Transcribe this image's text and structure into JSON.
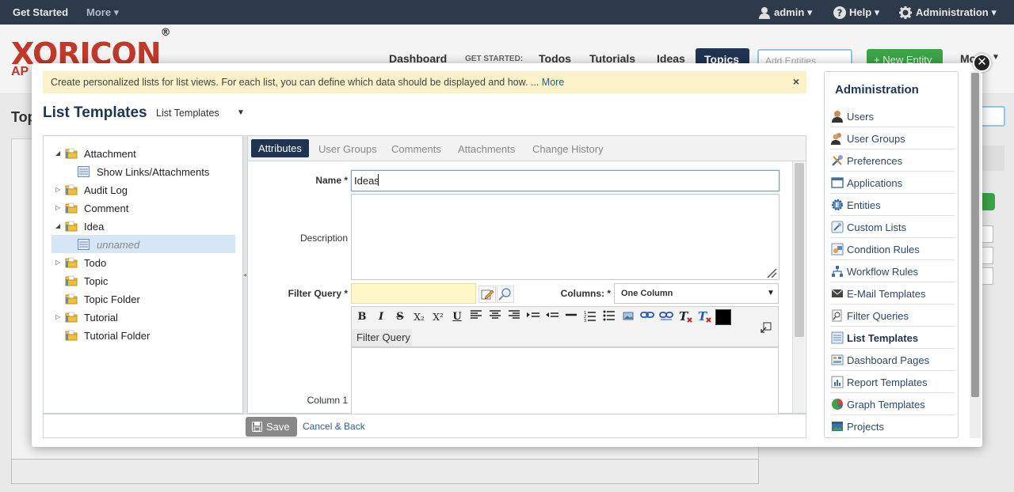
{
  "topbar": {
    "get_started": "Get Started",
    "more": "More ▾",
    "user": "admin ▾",
    "help": "Help ▾",
    "administration": "Administration ▾"
  },
  "background": {
    "logo": "XORICON",
    "logo_reg": "®",
    "logo_sub": "AP",
    "nav": {
      "dashboard": "Dashboard",
      "get_started_label": "GET STARTED:",
      "todos": "Todos",
      "tutorials": "Tutorials",
      "ideas": "Ideas",
      "topics": "Topics"
    },
    "search_placeholder": "Add Entities",
    "new_entity": "New Entity",
    "more": "Mo",
    "page_title": "Top"
  },
  "notice": {
    "text": "Create personalized lists for list views. For each list, you can define which data should be displayed and how. ...",
    "more": "More",
    "close": "×"
  },
  "header": {
    "title": "List Templates",
    "selector": "List Templates",
    "selector_arrow": "▼"
  },
  "tree": [
    {
      "label": "Attachment",
      "expander": "◢",
      "icon": "folder-icon",
      "italic": false
    },
    {
      "label": "Show Links/Attachments",
      "expander": "",
      "icon": "list-icon",
      "italic": false
    },
    {
      "label": "Audit Log",
      "expander": "▷",
      "icon": "folder-icon",
      "italic": false
    },
    {
      "label": "Comment",
      "expander": "▷",
      "icon": "folder-icon",
      "italic": false
    },
    {
      "label": "Idea",
      "expander": "◢",
      "icon": "folder-icon",
      "italic": false
    },
    {
      "label": "unnamed",
      "expander": "",
      "icon": "list-icon",
      "italic": true
    },
    {
      "label": "Todo",
      "expander": "▷",
      "icon": "folder-icon",
      "italic": false
    },
    {
      "label": "Topic",
      "expander": "",
      "icon": "folder-icon",
      "italic": false
    },
    {
      "label": "Topic Folder",
      "expander": "",
      "icon": "folder-icon",
      "italic": false
    },
    {
      "label": "Tutorial",
      "expander": "▷",
      "icon": "folder-icon",
      "italic": false
    },
    {
      "label": "Tutorial Folder",
      "expander": "",
      "icon": "folder-icon",
      "italic": false
    }
  ],
  "tabs": {
    "attributes": "Attributes",
    "user_groups": "User Groups",
    "comments": "Comments",
    "attachments": "Attachments",
    "change_history": "Change History"
  },
  "form": {
    "name_label": "Name *",
    "name_value": "Ideas",
    "description_label": "Description",
    "description_value": "",
    "filter_query_label": "Filter Query *",
    "filter_query_value": "",
    "columns_label": "Columns: *",
    "columns_value": "One Column",
    "columns_arrow": "▼",
    "editor_tab": "Filter Query",
    "column1_label": "Column 1",
    "column1_value": ""
  },
  "toolbar": {
    "bold": "B",
    "italic": "I",
    "strike": "S",
    "subscript": "X₂",
    "superscript": "X²",
    "underline": "U"
  },
  "footer": {
    "save": "Save",
    "cancel": "Cancel & Back"
  },
  "sidebar": {
    "title": "Administration",
    "items": [
      {
        "label": "Users",
        "icon": "users-icon"
      },
      {
        "label": "User Groups",
        "icon": "user-groups-icon"
      },
      {
        "label": "Preferences",
        "icon": "preferences-icon"
      },
      {
        "label": "Applications",
        "icon": "applications-icon"
      },
      {
        "label": "Entities",
        "icon": "entities-icon"
      },
      {
        "label": "Custom Lists",
        "icon": "custom-lists-icon"
      },
      {
        "label": "Condition Rules",
        "icon": "condition-rules-icon"
      },
      {
        "label": "Workflow Rules",
        "icon": "workflow-rules-icon"
      },
      {
        "label": "E-Mail Templates",
        "icon": "email-templates-icon"
      },
      {
        "label": "Filter Queries",
        "icon": "filter-queries-icon"
      },
      {
        "label": "List Templates",
        "icon": "list-templates-icon"
      },
      {
        "label": "Dashboard Pages",
        "icon": "dashboard-pages-icon"
      },
      {
        "label": "Report Templates",
        "icon": "report-templates-icon"
      },
      {
        "label": "Graph Templates",
        "icon": "graph-templates-icon"
      },
      {
        "label": "Projects",
        "icon": "projects-icon"
      }
    ]
  },
  "colors": {
    "navy": "#1f3450",
    "topbar": "#2d3a4a",
    "notice": "#fbf2c9",
    "selection": "#d6e6f6",
    "accent_green": "#3aa446"
  }
}
